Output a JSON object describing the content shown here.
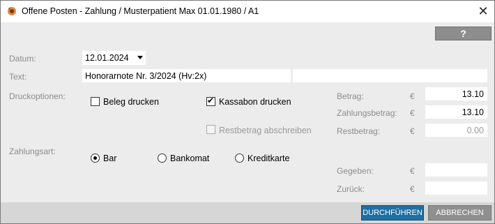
{
  "window": {
    "title": "Offene Posten - Zahlung / Musterpatient Max 01.01.1980 / A1",
    "close_label": "✕",
    "help_label": "?"
  },
  "form": {
    "datum_label": "Datum:",
    "datum_value": "12.01.2024",
    "text_label": "Text:",
    "text_value": "Honorarnote Nr. 3/2024 (Hv:2x)",
    "text_value_2": "",
    "druckoptionen_label": "Druckoptionen:",
    "beleg_drucken": {
      "label": "Beleg drucken",
      "checked": false
    },
    "kassabon_drucken": {
      "label": "Kassabon drucken",
      "checked": true
    },
    "restbetrag_abschreiben": {
      "label": "Restbetrag abschreiben",
      "checked": false,
      "disabled": true
    },
    "zahlungsart_label": "Zahlungsart:",
    "zahlungsart_options": [
      "Bar",
      "Bankomat",
      "Kreditkarte"
    ],
    "zahlungsart_selected": "Bar"
  },
  "amounts": {
    "currency": "€",
    "betrag_label": "Betrag:",
    "betrag_value": "13.10",
    "zahlungsbetrag_label": "Zahlungsbetrag:",
    "zahlungsbetrag_value": "13.10",
    "restbetrag_label": "Restbetrag:",
    "restbetrag_value": "0.00",
    "gegeben_label": "Gegeben:",
    "gegeben_value": "",
    "zurueck_label": "Zurück:",
    "zurueck_value": ""
  },
  "buttons": {
    "durchfuehren": "DURCHFÜHREN",
    "abbrechen": "ABBRECHEN"
  },
  "colors": {
    "primary_button": "#1f6fa3",
    "secondary_button": "#8f8f8f",
    "help_bar": "#8d8d8d",
    "label_gray": "#8c8c8c"
  }
}
